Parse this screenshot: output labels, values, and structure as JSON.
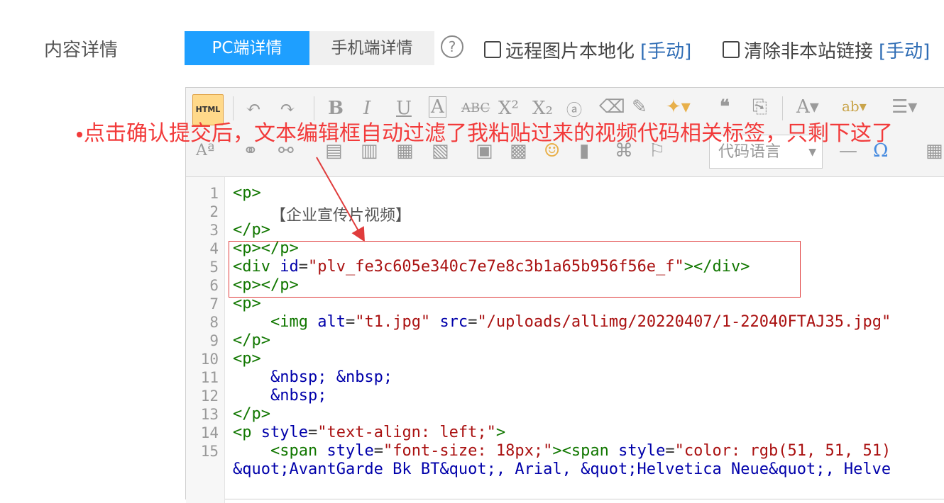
{
  "form": {
    "label": "内容详情",
    "tabs": [
      {
        "label": "PC端详情",
        "active": true
      },
      {
        "label": "手机端详情",
        "active": false
      }
    ],
    "help_glyph": "?",
    "options": [
      {
        "label": "远程图片本地化",
        "action": "[手动]"
      },
      {
        "label": "清除非本站链接",
        "action": "[手动]"
      }
    ]
  },
  "toolbar": {
    "html_button_label": "HTML",
    "language_placeholder": "代码语言"
  },
  "annotation": {
    "text": "点击确认提交后，文本编辑框自动过滤了我粘贴过来的视频代码相关标签，只剩下这了",
    "color": "#f23a3a"
  },
  "code": {
    "line_numbers": [
      "1",
      "2",
      "3",
      "4",
      "5",
      "6",
      "7",
      "8",
      "9",
      "10",
      "11",
      "12",
      "13",
      "14",
      "15"
    ],
    "line2_text": "【企业宣传片视频】",
    "div_id": "\"plv_fe3c605e340c7e7e8c3b1a65b956f56e_f\"",
    "img_alt": "\"t1.jpg\"",
    "img_src": "\"/uploads/allimg/20220407/1-22040FTAJ35.jpg\"",
    "nbsp_line1": "&nbsp; &nbsp;",
    "nbsp_line2": "&nbsp;",
    "p_style": "\"text-align: left;\"",
    "span_style1": "\"font-size: 18px;\"",
    "span_style2": "\"color: rgb(51, 51, 51)",
    "cont_line": "&quot;AvantGarde Bk BT&quot;, Arial, &quot;Helvetica Neue&quot;, Helve"
  },
  "colors": {
    "tab_active": "#1e9fff",
    "highlight": "#e03c3c"
  }
}
